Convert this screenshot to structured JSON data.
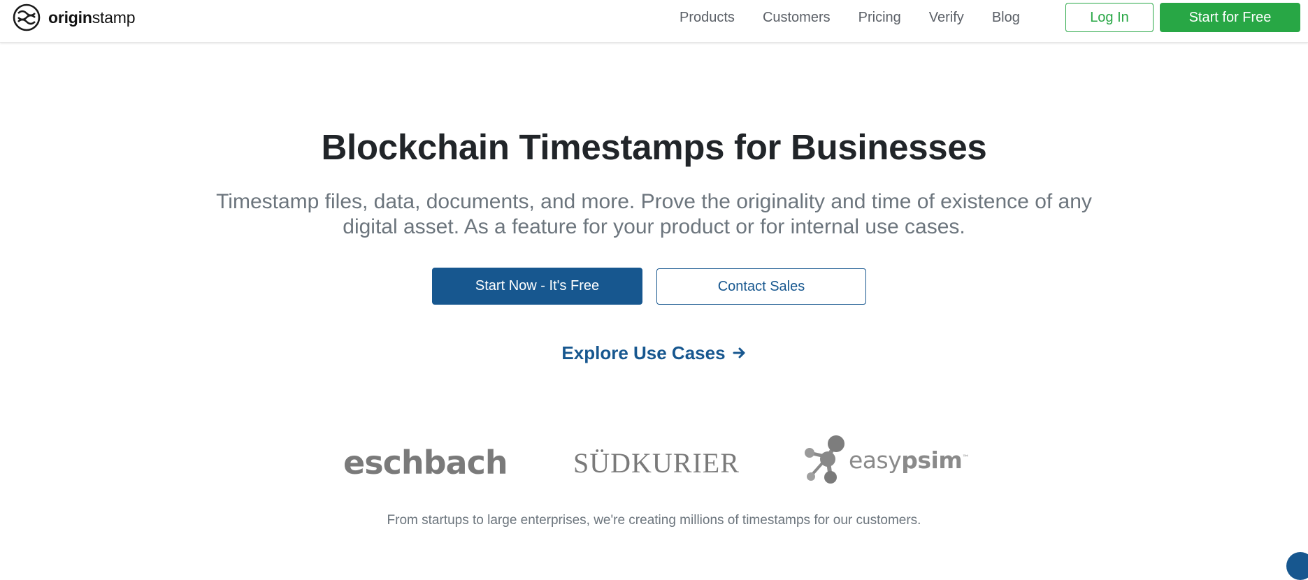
{
  "header": {
    "logo": {
      "bold_text": "origin",
      "regular_text": "stamp",
      "icon": "originstamp-logo-icon"
    },
    "nav": [
      {
        "label": "Products"
      },
      {
        "label": "Customers"
      },
      {
        "label": "Pricing"
      },
      {
        "label": "Verify"
      },
      {
        "label": "Blog"
      }
    ],
    "login_label": "Log In",
    "start_free_label": "Start for Free"
  },
  "hero": {
    "title": "Blockchain Timestamps for Businesses",
    "subtitle": "Timestamp files, data, documents, and more. Prove the originality and time of existence of any digital asset. As a feature for your product or for internal use cases.",
    "primary_button": "Start Now - It's Free",
    "secondary_button": "Contact Sales",
    "explore_link": "Explore Use Cases",
    "explore_icon": "arrow-right-icon"
  },
  "customers": {
    "logos": [
      {
        "name": "eschbach"
      },
      {
        "name": "SÜDKURIER"
      },
      {
        "name_regular": "easy",
        "name_bold": "psim",
        "tm": "™"
      }
    ],
    "caption": "From startups to large enterprises, we're creating millions of timestamps for our customers."
  },
  "colors": {
    "green": "#28a745",
    "blue": "#17578f",
    "muted": "#6c757d",
    "dark": "#212529"
  }
}
